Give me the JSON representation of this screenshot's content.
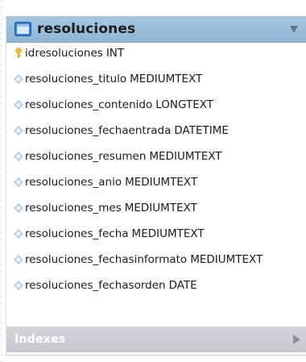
{
  "table": {
    "name": "resoluciones",
    "header_color": "#9dbfda",
    "columns": [
      {
        "name": "idresoluciones",
        "type": "INT",
        "icon": "primary-key-icon"
      },
      {
        "name": "resoluciones_titulo",
        "type": "MEDIUMTEXT",
        "icon": "nullable-column-icon"
      },
      {
        "name": "resoluciones_contenido",
        "type": "LONGTEXT",
        "icon": "nullable-column-icon"
      },
      {
        "name": "resoluciones_fechaentrada",
        "type": "DATETIME",
        "icon": "nullable-column-icon"
      },
      {
        "name": "resoluciones_resumen",
        "type": "MEDIUMTEXT",
        "icon": "nullable-column-icon"
      },
      {
        "name": "resoluciones_anio",
        "type": "MEDIUMTEXT",
        "icon": "nullable-column-icon"
      },
      {
        "name": "resoluciones_mes",
        "type": "MEDIUMTEXT",
        "icon": "nullable-column-icon"
      },
      {
        "name": "resoluciones_fecha",
        "type": "MEDIUMTEXT",
        "icon": "nullable-column-icon"
      },
      {
        "name": "resoluciones_fechasinformato",
        "type": "MEDIUMTEXT",
        "icon": "nullable-column-icon"
      },
      {
        "name": "resoluciones_fechasorden",
        "type": "DATE",
        "icon": "nullable-column-icon"
      }
    ],
    "indexes_label": "Indexes"
  },
  "icons": {
    "table": "table-icon",
    "collapse": "collapse-arrow-icon",
    "expand": "expand-arrow-icon"
  }
}
